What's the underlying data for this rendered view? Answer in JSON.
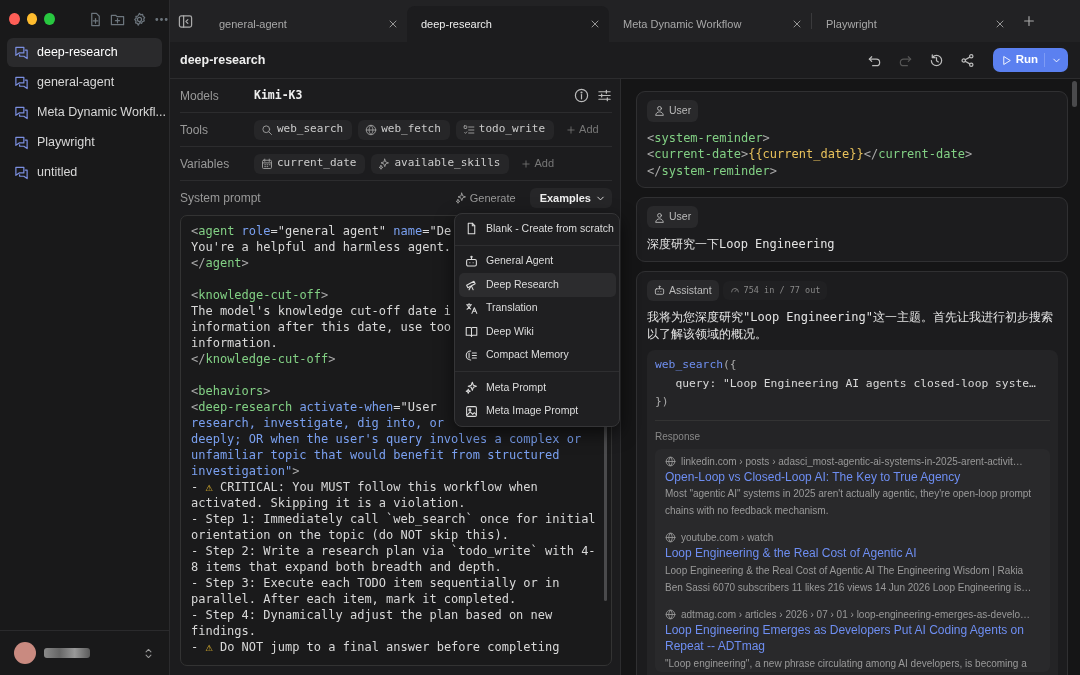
{
  "sidebar": {
    "items": [
      {
        "label": "deep-research",
        "selected": true
      },
      {
        "label": "general-agent",
        "selected": false
      },
      {
        "label": "Meta Dynamic Workfl...",
        "selected": false
      },
      {
        "label": "Playwright",
        "selected": false
      },
      {
        "label": "untitled",
        "selected": false
      }
    ]
  },
  "tabs": [
    {
      "label": "general-agent",
      "selected": false
    },
    {
      "label": "deep-research",
      "selected": true
    },
    {
      "label": "Meta Dynamic Workflow",
      "selected": false
    },
    {
      "label": "Playwright",
      "selected": false
    }
  ],
  "header": {
    "title": "deep-research",
    "run_button": "Run"
  },
  "config": {
    "models": {
      "label": "Models",
      "value": "Kimi-K3"
    },
    "tools": {
      "label": "Tools",
      "add": "Add",
      "items": [
        {
          "kind": "search",
          "label": "web_search"
        },
        {
          "kind": "globe",
          "label": "web_fetch"
        },
        {
          "kind": "list",
          "label": "todo_write"
        }
      ]
    },
    "variables": {
      "label": "Variables",
      "add": "Add",
      "items": [
        {
          "kind": "calendar",
          "label": "current_date"
        },
        {
          "kind": "sparkle",
          "label": "available_skills"
        }
      ]
    }
  },
  "system_prompt": {
    "label": "System prompt",
    "generate": "Generate",
    "examples": "Examples",
    "blocks": [
      {
        "lines": [
          {
            "segments": [
              {
                "kind": "p",
                "text": "<"
              },
              {
                "kind": "tag",
                "text": "agent"
              },
              {
                "kind": "attr",
                "text": " role"
              },
              {
                "kind": "str",
                "text": "=\"general agent\" "
              },
              {
                "kind": "attr",
                "text": "name"
              },
              {
                "kind": "str",
                "text": "=\"De"
              }
            ]
          },
          {
            "segments": [
              {
                "kind": "text",
                "text": "You're a helpful and harmless agent."
              }
            ]
          },
          {
            "segments": [
              {
                "kind": "p",
                "text": "</"
              },
              {
                "kind": "tag",
                "text": "agent"
              },
              {
                "kind": "p",
                "text": ">"
              }
            ]
          }
        ]
      },
      {
        "lines": [
          {
            "segments": [
              {
                "kind": "p",
                "text": "<"
              },
              {
                "kind": "tag",
                "text": "knowledge-cut-off"
              },
              {
                "kind": "p",
                "text": ">"
              }
            ]
          },
          {
            "segments": [
              {
                "kind": "text",
                "text": "The model's knowledge cut-off date i"
              }
            ]
          },
          {
            "segments": [
              {
                "kind": "text",
                "text": "information after this date, use too"
              }
            ]
          },
          {
            "segments": [
              {
                "kind": "text",
                "text": "information."
              }
            ]
          },
          {
            "segments": [
              {
                "kind": "p",
                "text": "</"
              },
              {
                "kind": "tag",
                "text": "knowledge-cut-off"
              },
              {
                "kind": "p",
                "text": ">"
              }
            ]
          }
        ]
      },
      {
        "lines": [
          {
            "segments": [
              {
                "kind": "p",
                "text": "<"
              },
              {
                "kind": "tag",
                "text": "behaviors"
              },
              {
                "kind": "p",
                "text": ">"
              }
            ]
          },
          {
            "segments": [
              {
                "kind": "p",
                "text": "<"
              },
              {
                "kind": "tag",
                "text": "deep-research"
              },
              {
                "kind": "attr",
                "text": " activate-when"
              },
              {
                "kind": "str",
                "text": "=\"User"
              }
            ]
          },
          {
            "segments": [
              {
                "kind": "attr",
                "text": "research, investigate, dig into, or"
              }
            ]
          },
          {
            "segments": [
              {
                "kind": "attr",
                "text": "deeply; OR when the user's query involves a complex or"
              }
            ]
          },
          {
            "segments": [
              {
                "kind": "attr",
                "text": "unfamiliar topic that would benefit from structured"
              }
            ]
          },
          {
            "segments": [
              {
                "kind": "attr",
                "text": "investigation\""
              },
              {
                "kind": "p",
                "text": ">"
              }
            ]
          },
          {
            "segments": [
              {
                "kind": "text",
                "text": "- "
              },
              {
                "kind": "warn",
                "text": "⚠"
              },
              {
                "kind": "text",
                "text": " CRITICAL: You MUST follow this workflow when"
              }
            ]
          },
          {
            "segments": [
              {
                "kind": "text",
                "text": "activated. Skipping it is a violation."
              }
            ]
          },
          {
            "segments": [
              {
                "kind": "text",
                "text": "- Step 1: Immediately call `web_search` once for initial"
              }
            ]
          },
          {
            "segments": [
              {
                "kind": "text",
                "text": "orientation on the topic (do NOT skip this)."
              }
            ]
          },
          {
            "segments": [
              {
                "kind": "text",
                "text": "- Step 2: Write a research plan via `todo_write` with 4-"
              }
            ]
          },
          {
            "segments": [
              {
                "kind": "text",
                "text": "8 items that expand both breadth and depth."
              }
            ]
          },
          {
            "segments": [
              {
                "kind": "text",
                "text": "- Step 3: Execute each TODO item sequentially or in"
              }
            ]
          },
          {
            "segments": [
              {
                "kind": "text",
                "text": "parallel. After each item, mark it completed."
              }
            ]
          },
          {
            "segments": [
              {
                "kind": "text",
                "text": "- Step 4: Dynamically adjust the plan based on new"
              }
            ]
          },
          {
            "segments": [
              {
                "kind": "text",
                "text": "findings."
              }
            ]
          },
          {
            "segments": [
              {
                "kind": "text",
                "text": "- "
              },
              {
                "kind": "warn",
                "text": "⚠"
              },
              {
                "kind": "text",
                "text": " Do NOT jump to a final answer before completing"
              }
            ]
          }
        ]
      }
    ]
  },
  "examples_menu": {
    "groups": [
      [
        {
          "kind": "file",
          "label": "Blank - Create from scratch",
          "selected": false
        }
      ],
      [
        {
          "kind": "robot",
          "label": "General Agent",
          "selected": false
        },
        {
          "kind": "telescope",
          "label": "Deep Research",
          "selected": true
        },
        {
          "kind": "translate",
          "label": "Translation",
          "selected": false
        },
        {
          "kind": "book",
          "label": "Deep Wiki",
          "selected": false
        },
        {
          "kind": "memory",
          "label": "Compact Memory",
          "selected": false
        }
      ],
      [
        {
          "kind": "sparkle",
          "label": "Meta Prompt",
          "selected": false
        },
        {
          "kind": "image",
          "label": "Meta Image Prompt",
          "selected": false
        }
      ]
    ]
  },
  "messages": [
    {
      "kind": "user",
      "role": "User",
      "code": [
        [
          {
            "kind": "p",
            "text": "<"
          },
          {
            "kind": "tag",
            "text": "system-reminder"
          },
          {
            "kind": "p",
            "text": ">"
          }
        ],
        [
          {
            "kind": "p",
            "text": "<"
          },
          {
            "kind": "tag",
            "text": "current-date"
          },
          {
            "kind": "p",
            "text": ">"
          },
          {
            "kind": "var",
            "text": "{{current_date}}"
          },
          {
            "kind": "p",
            "text": "</"
          },
          {
            "kind": "tag",
            "text": "current-date"
          },
          {
            "kind": "p",
            "text": ">"
          }
        ],
        [
          {
            "kind": "p",
            "text": "</"
          },
          {
            "kind": "tag",
            "text": "system-reminder"
          },
          {
            "kind": "p",
            "text": ">"
          }
        ]
      ]
    },
    {
      "kind": "user",
      "role": "User",
      "text": "深度研究一下Loop Engineering"
    },
    {
      "kind": "assistant",
      "role": "Assistant",
      "usage": "754 in / 77 out",
      "text": "我将为您深度研究\"Loop Engineering\"这一主题。首先让我进行初步搜索以了解该领域的概况。",
      "tool_call": [
        [
          {
            "kind": "fn",
            "text": "web_search"
          },
          {
            "kind": "p",
            "text": "({"
          }
        ],
        [
          {
            "kind": "text",
            "text": "   query: \"Loop Engineering AI agents closed-loop syste…"
          }
        ],
        [
          {
            "kind": "p",
            "text": "})"
          }
        ]
      ],
      "response_label": "Response",
      "results": [
        {
          "url": "linkedin.com › posts › adasci_most-agentic-ai-systems-in-2025-arent-activit…",
          "title": "Open-Loop vs Closed-Loop AI: The Key to True Agency",
          "snippet": "Most \"agentic AI\" systems in 2025 aren't actually agentic, they're open-loop prompt chains with no feedback mechanism."
        },
        {
          "url": "youtube.com › watch",
          "title": "Loop Engineering & the Real Cost of Agentic AI",
          "snippet": "Loop Engineering & the Real Cost of Agentic AI The Engineering Wisdom | Rakia Ben Sassi 6070 subscribers 11 likes 216 views 14 Jun 2026 Loop Engineering is…"
        },
        {
          "url": "adtmag.com › articles › 2026 › 07 › 01 › loop-engineering-emerges-as-develo…",
          "title": "Loop Engineering Emerges as Developers Put AI Coding Agents on Repeat -- ADTmag",
          "snippet": "\"Loop engineering\", a new phrase circulating among AI developers, is becoming a"
        }
      ]
    }
  ]
}
